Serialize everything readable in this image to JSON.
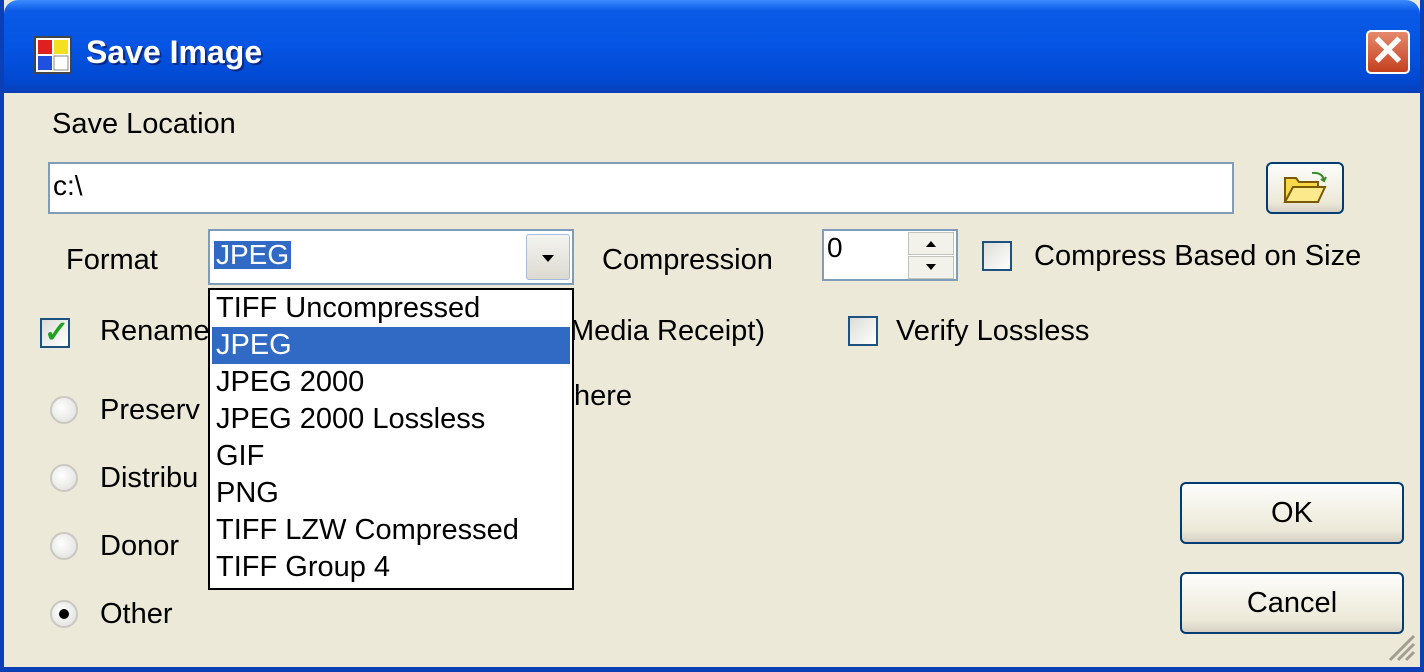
{
  "window": {
    "title": "Save Image",
    "close_label": "✕"
  },
  "save_location": {
    "label": "Save Location",
    "path": "c:\\"
  },
  "format": {
    "label": "Format",
    "selected": "JPEG",
    "options": [
      "TIFF Uncompressed",
      "JPEG",
      "JPEG 2000",
      "JPEG 2000 Lossless",
      "GIF",
      "PNG",
      "TIFF LZW Compressed",
      "TIFF Group 4"
    ],
    "highlighted_index": 1
  },
  "compression": {
    "label": "Compression",
    "value": "0",
    "compress_by_size_label": "Compress Based on Size",
    "compress_by_size_checked": false
  },
  "rename": {
    "label_start": "Rename",
    "label_end": "Media Receipt)",
    "checked": true
  },
  "verify_lossless": {
    "label": "Verify Lossless",
    "checked": false
  },
  "radio_options": [
    {
      "label": "Preserv",
      "selected": false
    },
    {
      "label": "Distribu",
      "selected": false
    },
    {
      "label": "Donor",
      "selected": false
    },
    {
      "label": "Other",
      "selected": true
    }
  ],
  "hidden_text_fragment": "here",
  "buttons": {
    "ok": "OK",
    "cancel": "Cancel"
  },
  "colors": {
    "titlebar": "#0554e3",
    "selection": "#316ac5",
    "face": "#ece9d8"
  }
}
